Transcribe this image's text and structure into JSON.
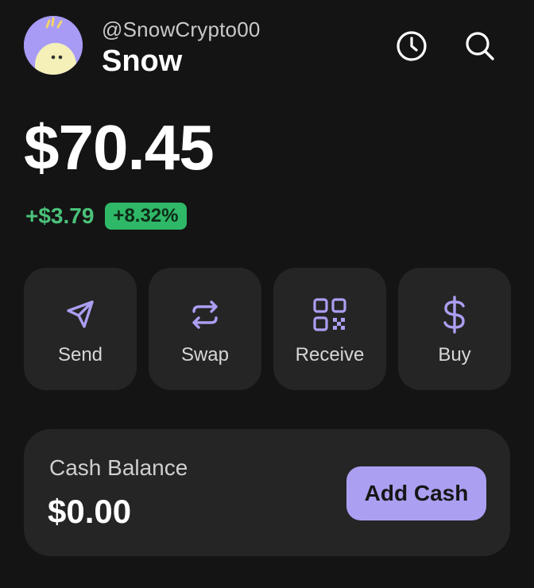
{
  "profile": {
    "handle": "@SnowCrypto00",
    "name": "Snow",
    "avatar_icon": "snow-avatar"
  },
  "header": {
    "history_icon": "clock-icon",
    "search_icon": "search-icon"
  },
  "portfolio": {
    "balance": "$70.45",
    "change_amount": "+$3.79",
    "change_percent": "+8.32%"
  },
  "actions": [
    {
      "label": "Send",
      "icon": "send-icon"
    },
    {
      "label": "Swap",
      "icon": "swap-icon"
    },
    {
      "label": "Receive",
      "icon": "qr-code-icon"
    },
    {
      "label": "Buy",
      "icon": "dollar-icon"
    }
  ],
  "cash": {
    "title": "Cash Balance",
    "value": "$0.00",
    "button_label": "Add Cash"
  },
  "colors": {
    "background": "#141414",
    "card": "#252525",
    "accent": "#ab9ff2",
    "positive": "#4ac27a",
    "positive_badge": "#2fb867"
  }
}
